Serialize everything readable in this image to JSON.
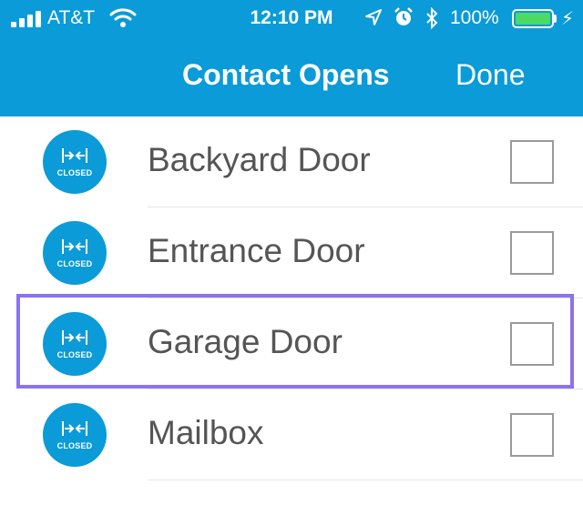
{
  "status_bar": {
    "carrier": "AT&T",
    "time": "12:10 PM",
    "battery_percent": "100%"
  },
  "nav": {
    "title": "Contact Opens",
    "done_label": "Done"
  },
  "colors": {
    "header": "#0a9bd8",
    "sensor_icon": "#0a9bd8",
    "highlight": "#8a73f0",
    "battery": "#4cd964"
  },
  "devices": [
    {
      "name": "Backyard Door",
      "status": "CLOSED",
      "checked": false
    },
    {
      "name": "Entrance Door",
      "status": "CLOSED",
      "checked": false
    },
    {
      "name": "Garage Door",
      "status": "CLOSED",
      "checked": false,
      "highlighted": true
    },
    {
      "name": "Mailbox",
      "status": "CLOSED",
      "checked": false
    }
  ]
}
